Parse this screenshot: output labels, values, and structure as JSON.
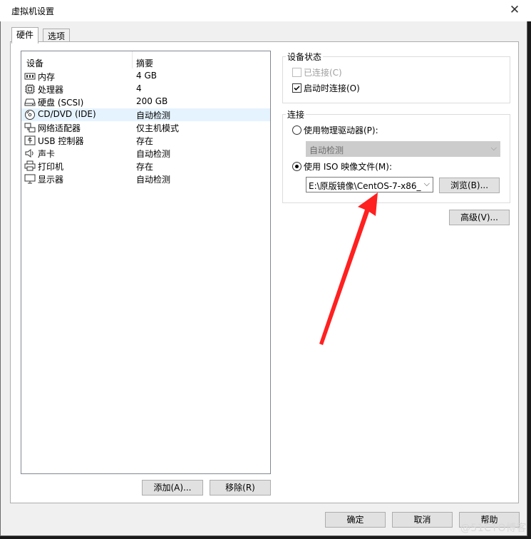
{
  "window": {
    "title": "虚拟机设置"
  },
  "tabs": [
    {
      "label": "硬件",
      "active": true
    },
    {
      "label": "选项",
      "active": false
    }
  ],
  "device_table": {
    "headers": {
      "device": "设备",
      "summary": "摘要"
    },
    "rows": [
      {
        "name": "内存",
        "summary": "4 GB",
        "icon": "memory-icon"
      },
      {
        "name": "处理器",
        "summary": "4",
        "icon": "cpu-icon"
      },
      {
        "name": "硬盘 (SCSI)",
        "summary": "200 GB",
        "icon": "hard-disk-icon"
      },
      {
        "name": "CD/DVD (IDE)",
        "summary": "自动检测",
        "icon": "cd-dvd-icon",
        "selected": true
      },
      {
        "name": "网络适配器",
        "summary": "仅主机模式",
        "icon": "network-adapter-icon"
      },
      {
        "name": "USB 控制器",
        "summary": "存在",
        "icon": "usb-icon"
      },
      {
        "name": "声卡",
        "summary": "自动检测",
        "icon": "speaker-icon"
      },
      {
        "name": "打印机",
        "summary": "存在",
        "icon": "printer-icon"
      },
      {
        "name": "显示器",
        "summary": "自动检测",
        "icon": "monitor-icon"
      }
    ]
  },
  "list_buttons": {
    "add": "添加(A)...",
    "remove": "移除(R)"
  },
  "device_status": {
    "title": "设备状态",
    "connected": {
      "label": "已连接(C)",
      "checked": false,
      "enabled": false
    },
    "connect_at_power_on": {
      "label": "启动时连接(O)",
      "checked": true,
      "enabled": true
    }
  },
  "connection": {
    "title": "连接",
    "physical": {
      "label": "使用物理驱动器(P):",
      "selected": false
    },
    "physical_drive_value": "自动检测",
    "iso": {
      "label": "使用 ISO 映像文件(M):",
      "selected": true
    },
    "iso_path": "E:\\原版镜像\\CentOS-7-x86_",
    "browse_label": "浏览(B)..."
  },
  "advanced_label": "高级(V)...",
  "footer": {
    "ok": "确定",
    "cancel": "取消",
    "help": "帮助"
  },
  "watermark": "@51CTO博客",
  "annotation_color": "#ff2020"
}
